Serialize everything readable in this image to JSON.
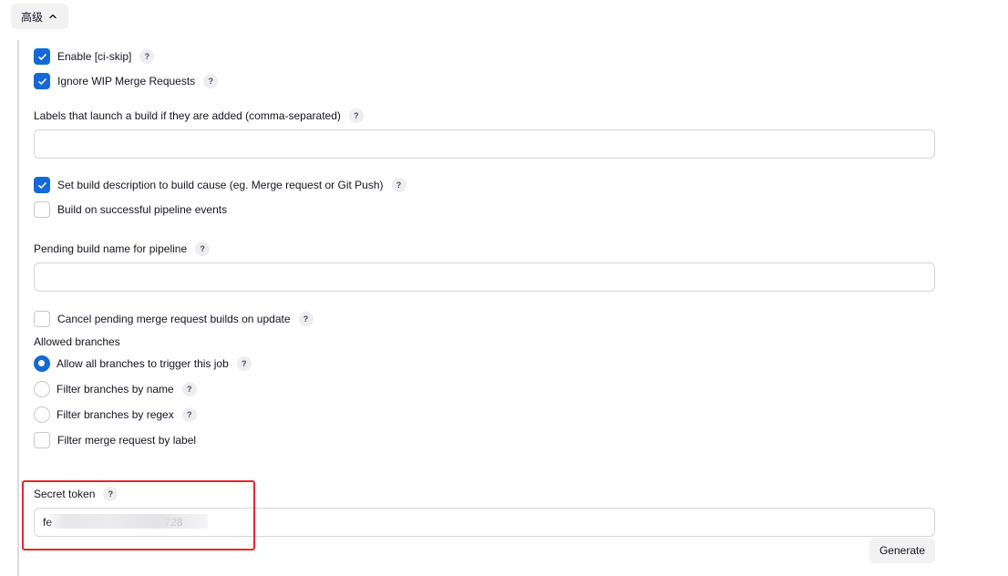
{
  "advanced": {
    "label": "高级"
  },
  "options": {
    "ci_skip": {
      "label": "Enable [ci-skip]",
      "checked": true
    },
    "ignore_wip": {
      "label": "Ignore WIP Merge Requests",
      "checked": true
    },
    "labels_field_label": "Labels that launch a build if they are added (comma-separated)",
    "labels_value": "",
    "set_description": {
      "label": "Set build description to build cause (eg. Merge request or Git Push)",
      "checked": true
    },
    "pipeline_events": {
      "label": "Build on successful pipeline events",
      "checked": false
    },
    "pending_name_label": "Pending build name for pipeline",
    "pending_name_value": "",
    "cancel_pending": {
      "label": "Cancel pending merge request builds on update",
      "checked": false
    }
  },
  "branches": {
    "heading": "Allowed branches",
    "all": {
      "label": "Allow all branches to trigger this job",
      "selected": true
    },
    "by_name": {
      "label": "Filter branches by name",
      "selected": false
    },
    "by_regex": {
      "label": "Filter branches by regex",
      "selected": false
    },
    "by_label": {
      "label": "Filter merge request by label",
      "checked": false
    }
  },
  "secret": {
    "label": "Secret token",
    "value_visible": "fe                                     728"
  },
  "help_glyph": "?",
  "generate_label": "Generate",
  "colors": {
    "accent": "#1569d6",
    "highlight": "#e8262b"
  }
}
